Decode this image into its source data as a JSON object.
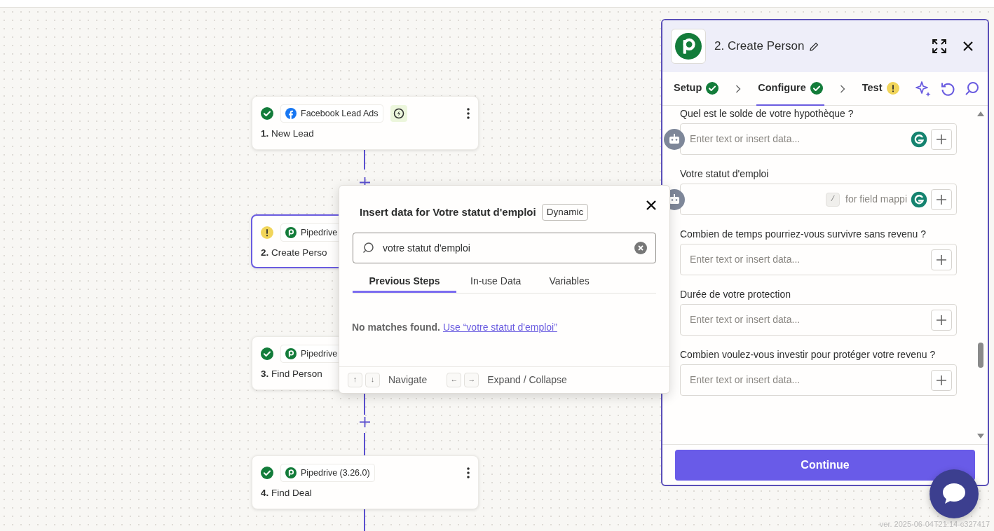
{
  "canvas": {
    "nodes": [
      {
        "warning": false,
        "kind": "facebook",
        "app": "Facebook Lead Ads",
        "trigger": true,
        "number": "1.",
        "title": "New Lead",
        "selected": false,
        "menu": true
      },
      {
        "warning": true,
        "kind": "pipedrive",
        "app": "Pipedrive",
        "number": "2.",
        "title": "Create Perso",
        "selected": true
      },
      {
        "warning": false,
        "kind": "pipedrive",
        "app": "Pipedrive",
        "number": "3.",
        "title": "Find Person",
        "selected": false
      },
      {
        "warning": false,
        "kind": "pipedrive",
        "app": "Pipedrive (3.26.0)",
        "trigger": false,
        "number": "4.",
        "title": "Find Deal",
        "selected": false,
        "menu": true
      }
    ],
    "version": "ver. 2025-06-04T21:14-c327417"
  },
  "popover": {
    "title": "Insert data for Votre statut d'emploi",
    "badge": "Dynamic",
    "search": "votre statut d'emploi",
    "tabs": [
      {
        "label": "Previous Steps",
        "selected": true
      },
      {
        "label": "In-use Data",
        "selected": false
      },
      {
        "label": "Variables",
        "selected": false
      }
    ],
    "empty_text": "No matches found.",
    "use_link": "Use “votre statut d'emploi”",
    "shortcuts": [
      {
        "keys": [
          "↑",
          "↓"
        ],
        "label": "Navigate"
      },
      {
        "keys": [
          "←",
          "→"
        ],
        "label": "Expand / Collapse"
      }
    ]
  },
  "panel": {
    "title": "2. Create Person",
    "steps": [
      {
        "label": "Setup",
        "warning": false,
        "selected": false
      },
      {
        "label": "Configure",
        "warning": false,
        "selected": true
      },
      {
        "label": "Test",
        "warning": true,
        "selected": false
      }
    ],
    "fields": [
      {
        "label": "Quel est le solde de votre hypothèque ?",
        "placeholder": "Enter text or insert data...",
        "grammarly": true,
        "robot": true
      },
      {
        "label": "Votre statut d'emploi",
        "hint_key": "/",
        "hint": "for field mappi",
        "grammarly": true,
        "robot": true
      },
      {
        "label": "Combien de temps pourriez-vous survivre sans revenu ?",
        "placeholder": "Enter text or insert data...",
        "grammarly": false,
        "robot": false
      },
      {
        "label": "Durée de votre protection",
        "placeholder": "Enter text or insert data...",
        "grammarly": false,
        "robot": false
      },
      {
        "label": "Combien voulez-vous investir pour protéger votre revenu ?",
        "placeholder": "Enter text or insert data...",
        "grammarly": false,
        "robot": false
      }
    ],
    "continue": "Continue"
  }
}
